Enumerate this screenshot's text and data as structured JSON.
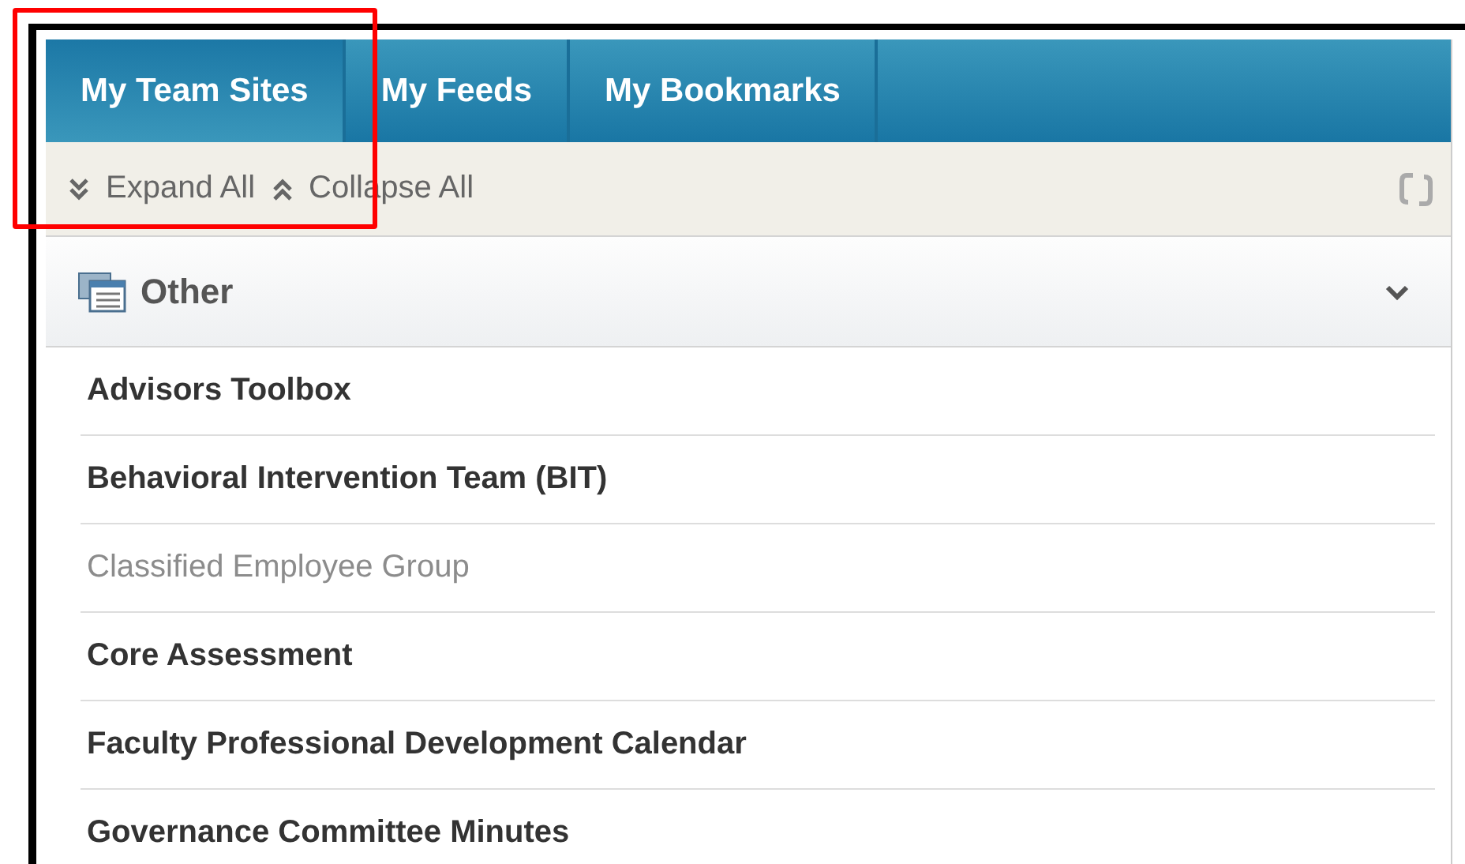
{
  "tabs": [
    {
      "label": "My Team Sites",
      "selected": true
    },
    {
      "label": "My Feeds",
      "selected": false
    },
    {
      "label": "My Bookmarks",
      "selected": false
    }
  ],
  "toolbar": {
    "expand_label": "Expand All",
    "collapse_label": "Collapse All"
  },
  "section": {
    "title": "Other",
    "expanded": true,
    "items": [
      {
        "label": "Advisors Toolbox",
        "disabled": false
      },
      {
        "label": "Behavioral Intervention Team (BIT)",
        "disabled": false
      },
      {
        "label": "Classified Employee Group",
        "disabled": true
      },
      {
        "label": "Core Assessment",
        "disabled": false
      },
      {
        "label": "Faculty Professional Development Calendar",
        "disabled": false
      },
      {
        "label": "Governance Committee Minutes",
        "disabled": false
      }
    ]
  }
}
